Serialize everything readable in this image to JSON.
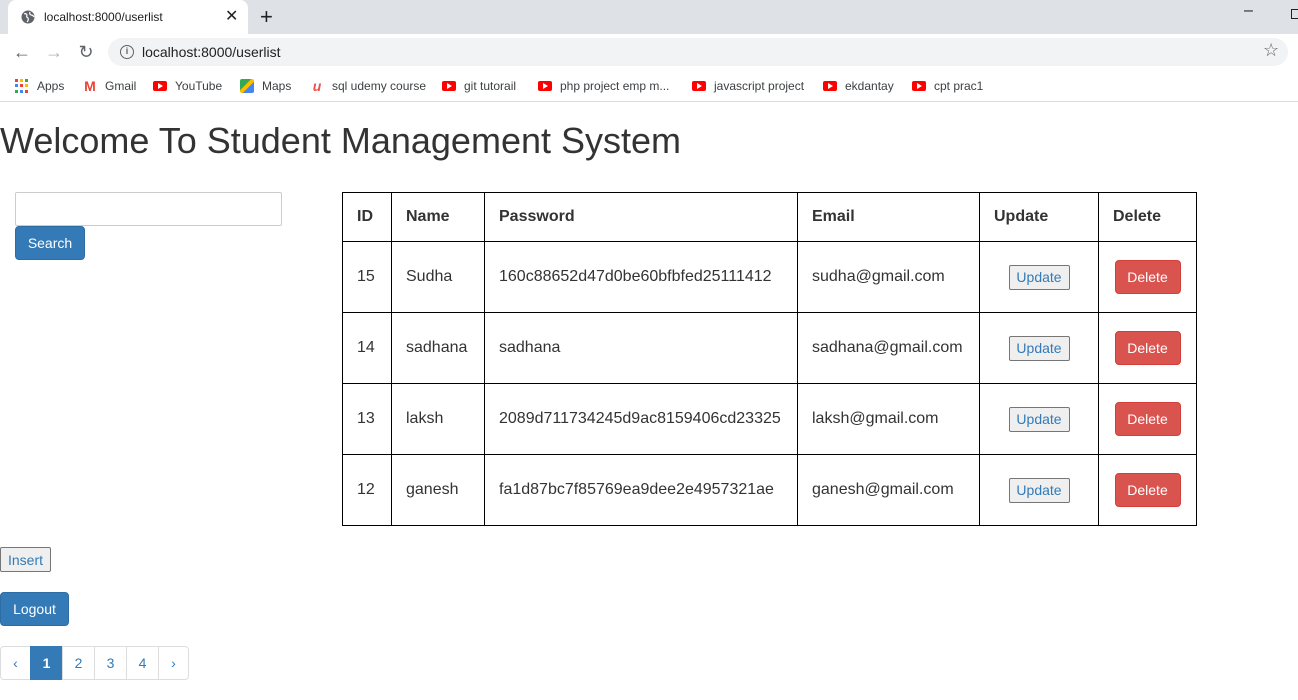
{
  "browser": {
    "tab_title": "localhost:8000/userlist",
    "close_glyph": "✕",
    "new_tab_glyph": "+",
    "minimize_glyph": "–",
    "back_glyph": "←",
    "forward_glyph": "→",
    "reload_glyph": "↻",
    "info_glyph": "i",
    "star_glyph": "☆",
    "url": "localhost:8000/userlist",
    "bookmarks": [
      {
        "label": "Apps",
        "icon": "apps-icon"
      },
      {
        "label": "Gmail",
        "icon": "gmail-icon"
      },
      {
        "label": "YouTube",
        "icon": "youtube-icon"
      },
      {
        "label": "Maps",
        "icon": "maps-icon"
      },
      {
        "label": "sql udemy course",
        "icon": "udemy-icon"
      },
      {
        "label": "git tutorail",
        "icon": "youtube-icon"
      },
      {
        "label": "php project emp m...",
        "icon": "youtube-icon"
      },
      {
        "label": "javascript project",
        "icon": "youtube-icon"
      },
      {
        "label": "ekdantay",
        "icon": "youtube-icon"
      },
      {
        "label": "cpt prac1",
        "icon": "youtube-icon"
      }
    ]
  },
  "page": {
    "title": "Welcome To Student Management System",
    "search": {
      "value": "",
      "button_label": "Search"
    },
    "insert_label": "Insert",
    "logout_label": "Logout"
  },
  "table": {
    "headers": {
      "id": "ID",
      "name": "Name",
      "password": "Password",
      "email": "Email",
      "update": "Update",
      "delete": "Delete"
    },
    "rows": [
      {
        "id": "15",
        "name": "Sudha",
        "password": "160c88652d47d0be60bfbfed25111412",
        "email": "sudha@gmail.com",
        "update_label": "Update",
        "delete_label": "Delete"
      },
      {
        "id": "14",
        "name": "sadhana",
        "password": "sadhana",
        "email": "sadhana@gmail.com",
        "update_label": "Update",
        "delete_label": "Delete"
      },
      {
        "id": "13",
        "name": "laksh",
        "password": "2089d711734245d9ac8159406cd23325",
        "email": "laksh@gmail.com",
        "update_label": "Update",
        "delete_label": "Delete"
      },
      {
        "id": "12",
        "name": "ganesh",
        "password": "fa1d87bc7f85769ea9dee2e4957321ae",
        "email": "ganesh@gmail.com",
        "update_label": "Update",
        "delete_label": "Delete"
      }
    ]
  },
  "pagination": {
    "prev": "‹",
    "pages": [
      "1",
      "2",
      "3",
      "4"
    ],
    "active": "1",
    "next": "›"
  },
  "colors": {
    "primary": "#337ab7",
    "danger": "#d9534f",
    "tabstrip": "#dee1e6"
  }
}
